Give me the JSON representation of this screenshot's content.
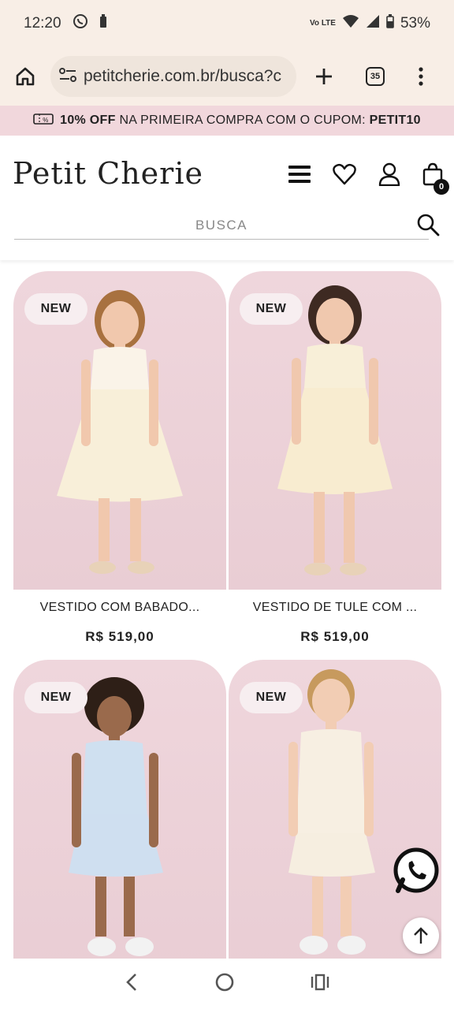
{
  "status_bar": {
    "time": "12:20",
    "network": "Vo LTE",
    "battery": "53%"
  },
  "browser": {
    "url": "petitcherie.com.br/busca?c",
    "tab_count": "35"
  },
  "promo": {
    "bold_prefix": "10% OFF",
    "text": "NA PRIMEIRA COMPRA COM O CUPOM:",
    "code": "PETIT10"
  },
  "header": {
    "logo": "Petit Cherie",
    "cart_count": "0",
    "search_placeholder": "BUSCA"
  },
  "products": [
    {
      "badge": "NEW",
      "name": "VESTIDO COM BABADO...",
      "price": "R$ 519,00",
      "dress_color": "#f8efd9"
    },
    {
      "badge": "NEW",
      "name": "VESTIDO DE TULE COM ...",
      "price": "R$ 519,00",
      "dress_color": "#f8ecd0"
    },
    {
      "badge": "NEW",
      "name": "",
      "price": "",
      "dress_color": "#cfdff0"
    },
    {
      "badge": "NEW",
      "name": "",
      "price": "",
      "dress_color": "#f6eee0"
    }
  ],
  "colors": {
    "promo_bg": "#f1d7dc",
    "browser_bg": "#f8eee6",
    "card_bg": "#ecd2d8"
  }
}
